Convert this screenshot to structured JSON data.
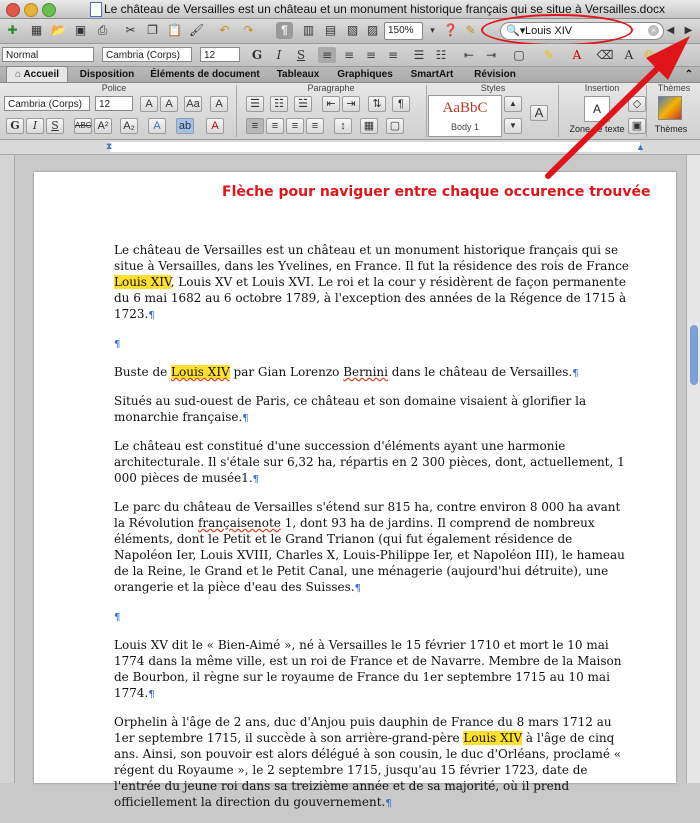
{
  "window": {
    "title": "Le château de Versailles est un château et un monument historique français qui se situe à Versailles.docx"
  },
  "toolbar": {
    "zoom": "150%",
    "search_value": "Louis XIV"
  },
  "format_bar": {
    "style": "Normal",
    "font": "Cambria (Corps)",
    "size": "12",
    "bold": "G",
    "italic": "I",
    "strike": "S"
  },
  "tabs": [
    {
      "label": "Accueil"
    },
    {
      "label": "Disposition"
    },
    {
      "label": "Éléments de document"
    },
    {
      "label": "Tableaux"
    },
    {
      "label": "Graphiques"
    },
    {
      "label": "SmartArt"
    },
    {
      "label": "Révision"
    }
  ],
  "ribbon": {
    "groups": {
      "police": "Police",
      "paragraphe": "Paragraphe",
      "styles": "Styles",
      "insertion": "Insertion",
      "themes": "Thèmes"
    },
    "font": "Cambria (Corps)",
    "size": "12",
    "style_preview": "AaBbC",
    "style_name": "Body 1",
    "textbox_label": "Zone de texte",
    "themes_label": "Thèmes"
  },
  "annotation": {
    "text": "Flèche pour naviguer entre chaque occurence trouvée",
    "color": "#e0151a"
  },
  "document": {
    "p1_a": "Le château de Versailles est un château et un monument historique français qui se situe à Versailles, dans les Yvelines, en France. Il fut la résidence des rois de France ",
    "p1_hl": "Louis XIV",
    "p1_b": ", Louis XV et Louis XVI. Le roi et la cour y résidèrent de façon permanente du 6 mai 1682 au 6 octobre 1789, à l'exception des années de la Régence de 1715 à 1723.",
    "pilcrow": "¶",
    "p2_a": "Buste de ",
    "p2_hl": "Louis XIV",
    "p2_b": " par Gian Lorenzo ",
    "p2_c": "Bernini",
    "p2_d": " dans le château de Versailles.",
    "p3": "Situés au sud-ouest de Paris, ce château et son domaine visaient à glorifier la monarchie française.",
    "p4": "Le château est constitué d'une succession d'éléments ayant une harmonie architecturale. Il s'étale sur 6,32 ha, répartis en 2 300 pièces, dont, actuellement, 1 000 pièces de musée1.",
    "p5_a": "Le parc du château de Versailles s'étend sur 815 ha, contre environ 8 000 ha avant la Révolution ",
    "p5_b": "françaisenote",
    "p5_c": " 1, dont 93 ha de jardins. Il comprend de nombreux éléments, dont le Petit et le Grand Trianon (qui fut également résidence de Napoléon Ier, Louis XVIII, Charles X, Louis-Philippe Ier, et Napoléon III), le hameau de la Reine, le Grand et le Petit Canal, une ménagerie (aujourd'hui détruite), une orangerie et la pièce d'eau des Suisses.",
    "p6": "Louis XV dit le « Bien-Aimé », né à Versailles le 15 février 1710 et mort le 10 mai 1774 dans la même ville, est un roi de France et de Navarre. Membre de la Maison de Bourbon, il règne sur le royaume de France du 1er septembre 1715 au 10 mai 1774.",
    "p7_a": "Orphelin à l'âge de 2 ans, duc d'Anjou puis dauphin de France du 8 mars 1712 au 1er septembre 1715, il succède à son arrière-grand-père ",
    "p7_hl": "Louis XIV",
    "p7_b": " à l'âge de cinq ans. Ainsi, son pouvoir est alors délégué à son cousin, le duc d'Orléans, proclamé « régent du Royaume », le 2 septembre 1715, jusqu'au 15 février 1723, date de l'entrée du jeune roi dans sa treizième année et de sa majorité, où il prend officiellement la direction du gouvernement."
  }
}
